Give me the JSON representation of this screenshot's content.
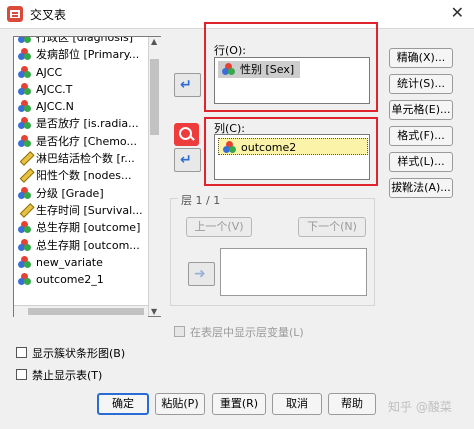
{
  "window": {
    "title": "交叉表",
    "close_glyph": "✕"
  },
  "variable_list": [
    {
      "label": "行政区 [diagnosis]",
      "icon": "nominal-icon"
    },
    {
      "label": "发病部位 [Primary...",
      "icon": "nominal-icon"
    },
    {
      "label": "AJCC",
      "icon": "nominal-icon"
    },
    {
      "label": "AJCC.T",
      "icon": "nominal-icon"
    },
    {
      "label": "AJCC.N",
      "icon": "nominal-icon"
    },
    {
      "label": "是否放疗 [is.radia...",
      "icon": "nominal-icon"
    },
    {
      "label": "是否化疗 [Chemo...",
      "icon": "nominal-icon"
    },
    {
      "label": "淋巴结活检个数 [r...",
      "icon": "scale-icon"
    },
    {
      "label": "阳性个数 [nodes...",
      "icon": "scale-icon"
    },
    {
      "label": "分级 [Grade]",
      "icon": "nominal-icon"
    },
    {
      "label": "生存时间 [Survival...",
      "icon": "scale-icon"
    },
    {
      "label": "总生存期 [outcome]",
      "icon": "nominal-icon"
    },
    {
      "label": "总生存期 [outcom...",
      "icon": "nominal-icon"
    },
    {
      "label": "new_variate",
      "icon": "nominal-icon"
    },
    {
      "label": "outcome2_1",
      "icon": "nominal-icon"
    }
  ],
  "row_section": {
    "label": "行(O):",
    "variable": "性别 [Sex]"
  },
  "col_section": {
    "label": "列(C):",
    "variable": "outcome2"
  },
  "right_buttons": [
    "精确(X)...",
    "统计(S)...",
    "单元格(E)...",
    "格式(F)...",
    "样式(L)...",
    "拔靴法(A)..."
  ],
  "layer": {
    "label": "层 1 / 1",
    "prev_label": "上一个(V)",
    "next_label": "下一个(N)",
    "display_layers_label": "在表层中显示层变量(L)"
  },
  "checkboxes": {
    "clustered_bar": "显示簇状条形图(B)",
    "suppress_tables": "禁止显示表(T)"
  },
  "bottom_buttons": {
    "ok": "确定",
    "paste": "粘贴(P)",
    "reset": "重置(R)",
    "cancel": "取消",
    "help": "帮助"
  },
  "watermark": "知乎 @酸菜",
  "colors": {
    "highlight_frame": "#e0232c",
    "accent": "#2b6cd4"
  }
}
